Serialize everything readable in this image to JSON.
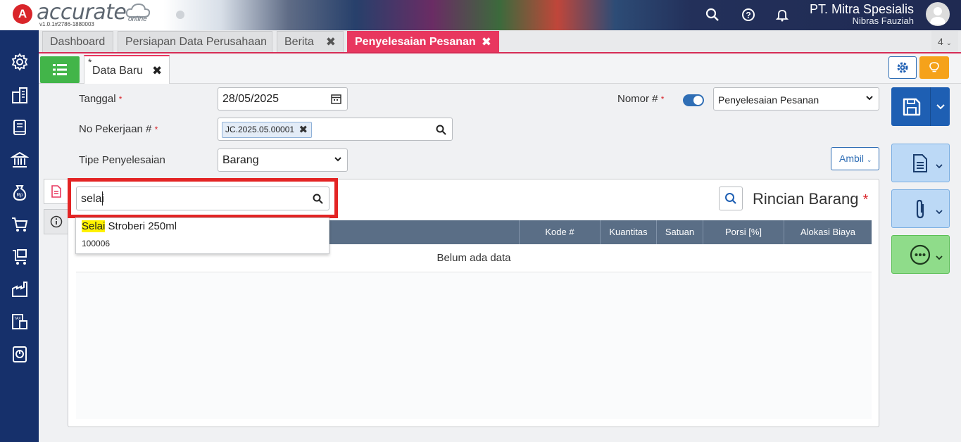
{
  "app": {
    "logo_letter": "A",
    "logo_text": "accurate",
    "logo_sub": "online",
    "version": "v1.0.1#2786-1880003",
    "company": "PT. Mitra Spesialis",
    "user": "Nibras Fauziah"
  },
  "tabs": [
    {
      "label": "Dashboard"
    },
    {
      "label": "Persiapan Data Perusahaan"
    },
    {
      "label": "Berita",
      "close": "✖"
    },
    {
      "label": "Penyelesaian Pesanan",
      "close": "✖"
    }
  ],
  "tab_count": "4",
  "doc_tab": {
    "star": "*",
    "label": "Data Baru",
    "close": "✖"
  },
  "form": {
    "tanggal_label": "Tanggal",
    "tanggal_value": "28/05/2025",
    "no_pekerjaan_label": "No Pekerjaan #",
    "no_pekerjaan_chip": "JC.2025.05.00001",
    "tipe_label": "Tipe Penyelesaian",
    "tipe_value": "Barang",
    "nomor_label": "Nomor #",
    "nomor_value": "Penyelesaian Pesanan",
    "required_mark": "*",
    "ambil_label": "Ambil"
  },
  "detail": {
    "search_value": "selai",
    "suggestion_highlight": "Selai",
    "suggestion_rest": " Stroberi 250ml",
    "suggestion_code": "100006",
    "title": "Rincian Barang",
    "columns": [
      "Kode #",
      "Kuantitas",
      "Satuan",
      "Porsi [%]",
      "Alokasi Biaya"
    ],
    "empty_text": "Belum ada data"
  },
  "colors": {
    "accent_pink": "#e8375f",
    "sidebar_blue": "#16306b",
    "primary_blue": "#1e5fb3",
    "green": "#42b549",
    "highlight_box": "#e32424"
  }
}
